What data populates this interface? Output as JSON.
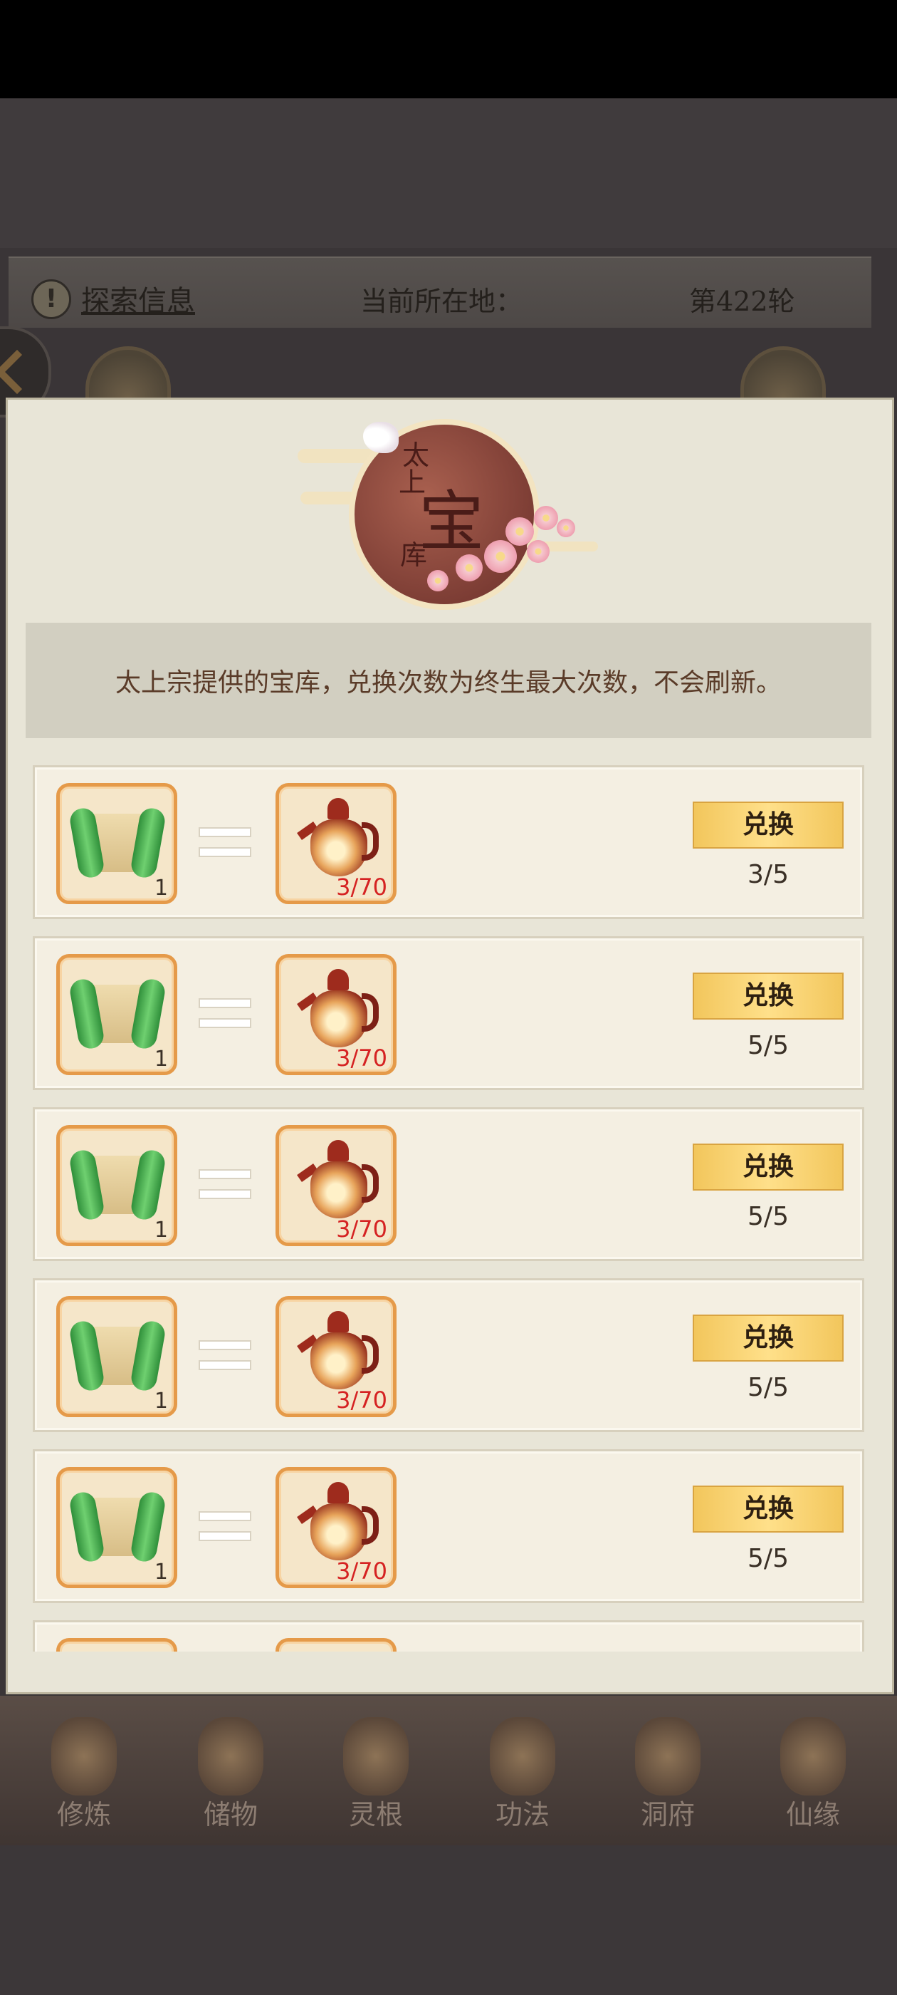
{
  "header": {
    "explore_info": "探索信息",
    "current_location_label": "当前所在地：",
    "round": "第422轮"
  },
  "emblem": {
    "char_tai": "太",
    "char_shang": "上",
    "char_bao": "宝",
    "char_ku": "库"
  },
  "notice": "太上宗提供的宝库，兑换次数为终生最大次数，不会刷新。",
  "exchange_rows": [
    {
      "reward_count": "1",
      "cost": "3/70",
      "button": "兑换",
      "limit": "3/5"
    },
    {
      "reward_count": "1",
      "cost": "3/70",
      "button": "兑换",
      "limit": "5/5"
    },
    {
      "reward_count": "1",
      "cost": "3/70",
      "button": "兑换",
      "limit": "5/5"
    },
    {
      "reward_count": "1",
      "cost": "3/70",
      "button": "兑换",
      "limit": "5/5"
    },
    {
      "reward_count": "1",
      "cost": "3/70",
      "button": "兑换",
      "limit": "5/5"
    }
  ],
  "bottom_nav": [
    {
      "label": "修炼",
      "icon": "cultivation-icon"
    },
    {
      "label": "储物",
      "icon": "storage-bag-icon"
    },
    {
      "label": "灵根",
      "icon": "spirit-root-icon"
    },
    {
      "label": "功法",
      "icon": "technique-book-icon"
    },
    {
      "label": "洞府",
      "icon": "cave-dwelling-icon"
    },
    {
      "label": "仙缘",
      "icon": "immortal-fate-icon"
    }
  ],
  "colors": {
    "panel_bg": "#e8e5d7",
    "slot_border": "#e59a49",
    "cost_text": "#d52222",
    "button_gold": "#f2c65c"
  }
}
